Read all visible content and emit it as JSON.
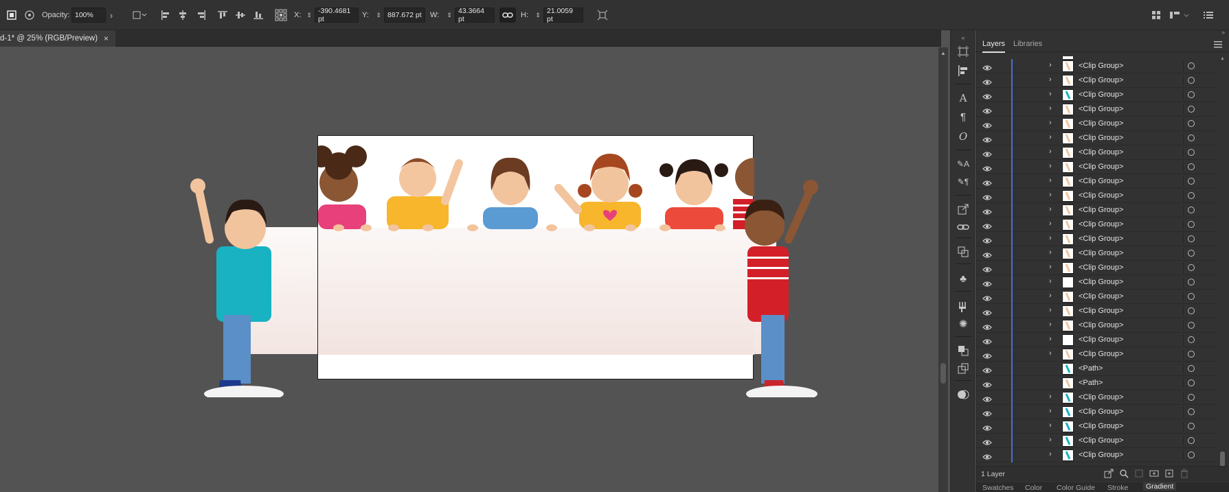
{
  "toolbar": {
    "opacity_label": "Opacity:",
    "opacity_value": "100%",
    "x_label": "X:",
    "x_value": "-390.4681 pt",
    "y_label": "Y:",
    "y_value": "887.672 pt",
    "w_label": "W:",
    "w_value": "43.3664 pt",
    "h_label": "H:",
    "h_value": "21.0059 pt"
  },
  "document_tab": {
    "title": "d-1* @ 25% (RGB/Preview)",
    "close": "×"
  },
  "panel": {
    "tabs": [
      "Layers",
      "Libraries"
    ],
    "active_tab": "Layers",
    "layer_count": "1 Layer",
    "rows": [
      {
        "label": "<Clip Group>",
        "expandable": true
      },
      {
        "label": "<Clip Group>",
        "expandable": true
      },
      {
        "label": "<Clip Group>",
        "expandable": true
      },
      {
        "label": "<Clip Group>",
        "expandable": true
      },
      {
        "label": "<Clip Group>",
        "expandable": true
      },
      {
        "label": "<Clip Group>",
        "expandable": true
      },
      {
        "label": "<Clip Group>",
        "expandable": true
      },
      {
        "label": "<Clip Group>",
        "expandable": true
      },
      {
        "label": "<Clip Group>",
        "expandable": true
      },
      {
        "label": "<Clip Group>",
        "expandable": true
      },
      {
        "label": "<Clip Group>",
        "expandable": true
      },
      {
        "label": "<Clip Group>",
        "expandable": true
      },
      {
        "label": "<Clip Group>",
        "expandable": true
      },
      {
        "label": "<Clip Group>",
        "expandable": true
      },
      {
        "label": "<Clip Group>",
        "expandable": true
      },
      {
        "label": "<Clip Group>",
        "expandable": true
      },
      {
        "label": "<Clip Group>",
        "expandable": true
      },
      {
        "label": "<Clip Group>",
        "expandable": true
      },
      {
        "label": "<Clip Group>",
        "expandable": true
      },
      {
        "label": "<Clip Group>",
        "expandable": true
      },
      {
        "label": "<Clip Group>",
        "expandable": true
      },
      {
        "label": "<Path>",
        "expandable": false
      },
      {
        "label": "<Path>",
        "expandable": false
      },
      {
        "label": "<Clip Group>",
        "expandable": true
      },
      {
        "label": "<Clip Group>",
        "expandable": true
      },
      {
        "label": "<Clip Group>",
        "expandable": true
      },
      {
        "label": "<Clip Group>",
        "expandable": true
      },
      {
        "label": "<Clip Group>",
        "expandable": true
      }
    ]
  },
  "bottom_tabs": [
    "Swatches",
    "Color",
    "Color Guide",
    "Stroke",
    "Gradient"
  ],
  "bottom_active": "Gradient"
}
